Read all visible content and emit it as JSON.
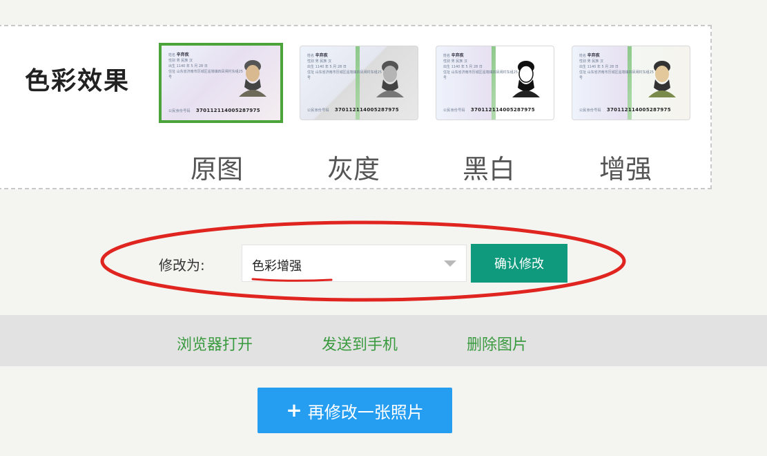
{
  "effects": {
    "title": "色彩效果",
    "options": [
      {
        "label": "原图",
        "selected": true
      },
      {
        "label": "灰度",
        "selected": false
      },
      {
        "label": "黑白",
        "selected": false
      },
      {
        "label": "增强",
        "selected": false
      }
    ],
    "card": {
      "name_label": "姓名",
      "name": "辛弃疾",
      "gender_label": "性别",
      "gender": "男",
      "ethnicity_label": "民族",
      "ethnicity": "汉",
      "birth_label": "出生",
      "birth": "1140 年 5 月 28 日",
      "address_label": "住址",
      "address": "山东省济南市历城区遥墙镇四凤闸村东组25号",
      "id_label": "公民身份号码",
      "id_number": "370112114005287975"
    }
  },
  "modify": {
    "label": "修改为:",
    "selected_value": "色彩增强",
    "confirm_label": "确认修改"
  },
  "actions": {
    "open_browser": "浏览器打开",
    "send_phone": "发送到手机",
    "delete_image": "删除图片"
  },
  "again_button": {
    "icon": "+",
    "label": "再修改一张照片"
  },
  "colors": {
    "selected_border": "#4aa43a",
    "confirm_button": "#0f9a7d",
    "link": "#3a9a3f",
    "primary_button": "#259ef2",
    "annotation": "#e0241f"
  }
}
